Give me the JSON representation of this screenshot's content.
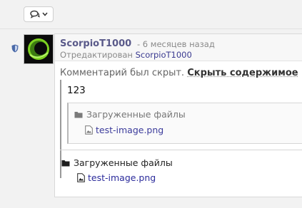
{
  "comment": {
    "author": "ScorpioT1000",
    "time": "- 6 месяцев назад",
    "edited_label": "Отредактирован",
    "edited_by": "ScorpioT1000",
    "hidden_text": "Комментарий был скрыт.",
    "show_content_link": "Скрыть содержимое",
    "quote_text": "123",
    "inner_files": {
      "title": "Загруженные файлы",
      "files": [
        "test-image.png"
      ]
    },
    "outer_files": {
      "title": "Загруженные файлы",
      "files": [
        "test-image.png"
      ]
    }
  },
  "icons": {
    "toolbar": "comments-icon",
    "dropdown": "chevron-down-icon",
    "moderator": "shield-icon",
    "folder": "folder-icon",
    "file": "image-file-icon"
  },
  "colors": {
    "author": "#5a5a8a",
    "link": "#3b3b9b",
    "avatar_accent": "#7ed321"
  }
}
